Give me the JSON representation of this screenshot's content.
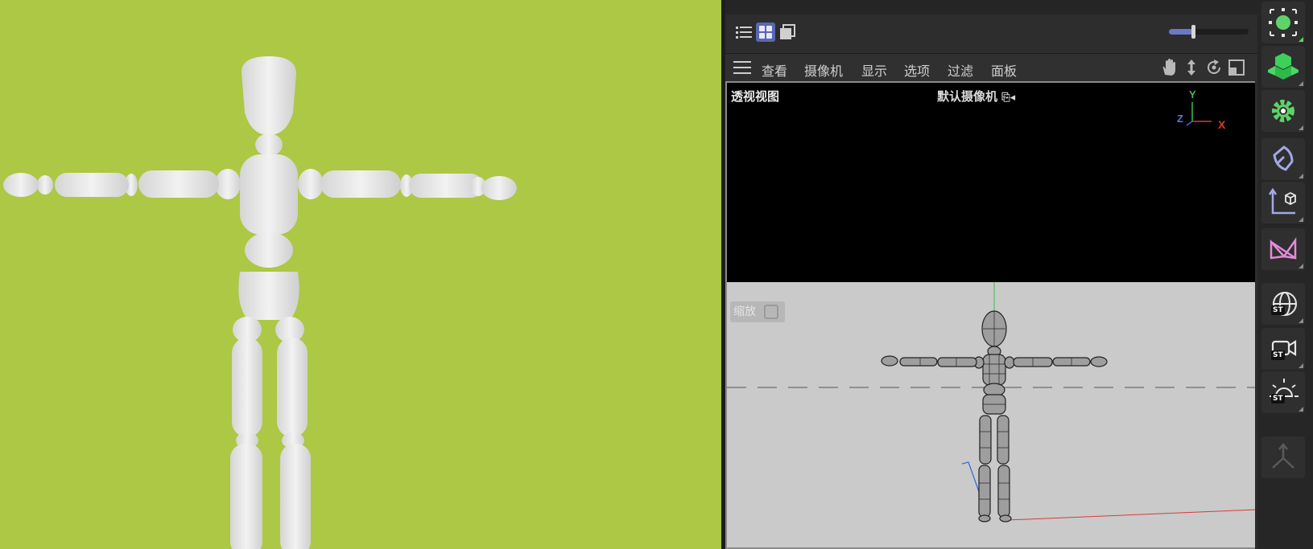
{
  "menubar": {
    "items": [
      "查看",
      "摄像机",
      "显示",
      "选项",
      "过滤",
      "面板"
    ]
  },
  "viewport": {
    "view_name": "透视视图",
    "camera_name": "默认摄像机",
    "zoom_badge": "缩放",
    "axes": {
      "y": "Y",
      "z": "Z",
      "x": "X"
    }
  },
  "zoom_slider": {
    "value": 0.3
  },
  "toolbar": {
    "st_badge": "ST",
    "tools": [
      "null-object-icon",
      "cube-icon",
      "gear-icon",
      "spline-pen-icon",
      "coordinate-system-icon",
      "deformer-icon",
      "sky-globe-icon",
      "camera-icon",
      "light-icon",
      "joint-icon"
    ]
  },
  "colors": {
    "render_bg": "#acc844",
    "accent": "#5a67b0",
    "viewport_bg": "#cacaca"
  }
}
